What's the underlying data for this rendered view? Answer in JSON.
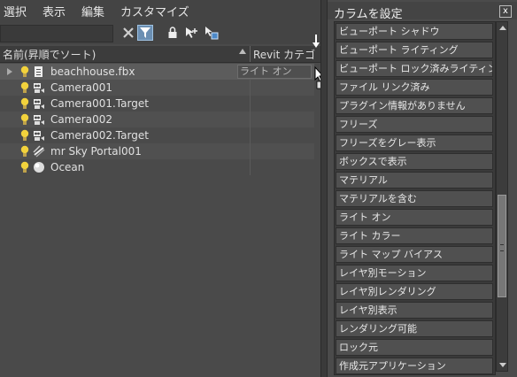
{
  "menu": {
    "items": [
      "選択",
      "表示",
      "編集",
      "カスタマイズ"
    ]
  },
  "explorer": {
    "header": {
      "name_col": "名前(昇順でソート)",
      "revit_col": "Revit カテゴリ"
    },
    "rows": [
      {
        "label": "beachhouse.fbx",
        "icon": "file-icon",
        "expandable": true
      },
      {
        "label": "Camera001",
        "icon": "camera-icon"
      },
      {
        "label": "Camera001.Target",
        "icon": "camera-icon"
      },
      {
        "label": "Camera002",
        "icon": "camera-icon"
      },
      {
        "label": "Camera002.Target",
        "icon": "camera-icon"
      },
      {
        "label": "mr Sky Portal001",
        "icon": "light-icon"
      },
      {
        "label": "Ocean",
        "icon": "sphere-icon"
      }
    ],
    "drag_column_label": "ライト オン"
  },
  "dialog": {
    "title": "カラムを設定",
    "close": "x",
    "items": [
      "ビューポート シャドウ",
      "ビューポート ライティング",
      "ビューポート ロック済みライティング",
      "ファイル リンク済み",
      "プラグイン情報がありません",
      "フリーズ",
      "フリーズをグレー表示",
      "ボックスで表示",
      "マテリアル",
      "マテリアルを含む",
      "ライト オン",
      "ライト カラー",
      "ライト マップ バイアス",
      "レイヤ別モーション",
      "レイヤ別レンダリング",
      "レイヤ別表示",
      "レンダリング可能",
      "ロック元",
      "作成元アプリケーション"
    ]
  },
  "colors": {
    "accent": "#6b8fb3",
    "bulb": "#f2d23c"
  }
}
